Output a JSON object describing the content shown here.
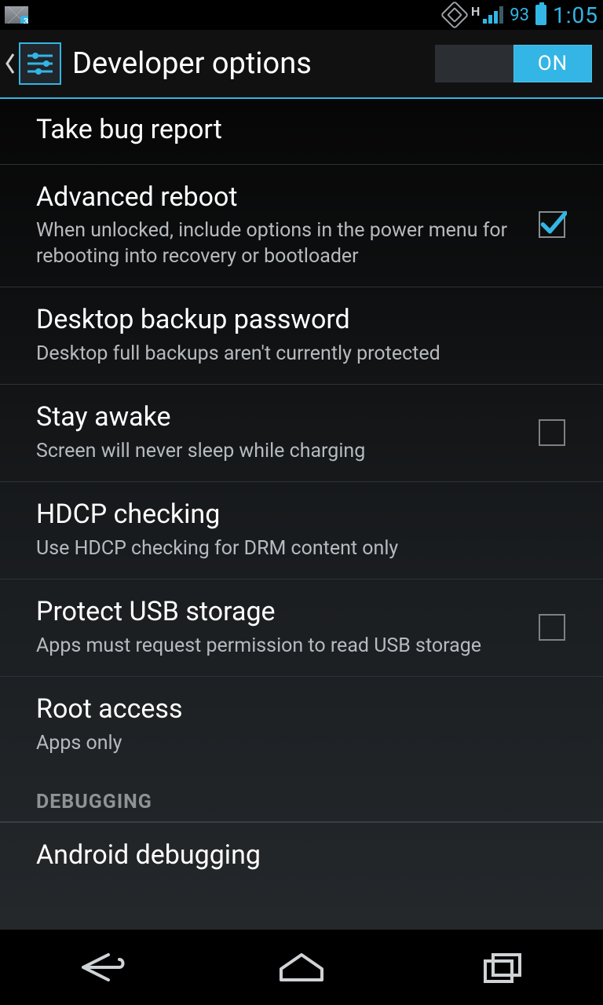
{
  "status": {
    "gmail_badge": "3",
    "network_type": "H",
    "battery_pct": "93",
    "clock": "1:05"
  },
  "header": {
    "title": "Developer options",
    "toggle_on_label": "ON",
    "toggle_state": "on"
  },
  "items": {
    "bug_report": {
      "title": "Take bug report"
    },
    "advanced_reboot": {
      "title": "Advanced reboot",
      "sub": "When unlocked, include options in the power menu for rebooting into recovery or bootloader",
      "checked": true
    },
    "desktop_backup": {
      "title": "Desktop backup password",
      "sub": "Desktop full backups aren't currently protected"
    },
    "stay_awake": {
      "title": "Stay awake",
      "sub": "Screen will never sleep while charging",
      "checked": false
    },
    "hdcp": {
      "title": "HDCP checking",
      "sub": "Use HDCP checking for DRM content only"
    },
    "protect_usb": {
      "title": "Protect USB storage",
      "sub": "Apps must request permission to read USB storage",
      "checked": false
    },
    "root_access": {
      "title": "Root access",
      "sub": "Apps only"
    },
    "android_debugging": {
      "title": "Android debugging"
    }
  },
  "sections": {
    "debugging": "DEBUGGING"
  }
}
